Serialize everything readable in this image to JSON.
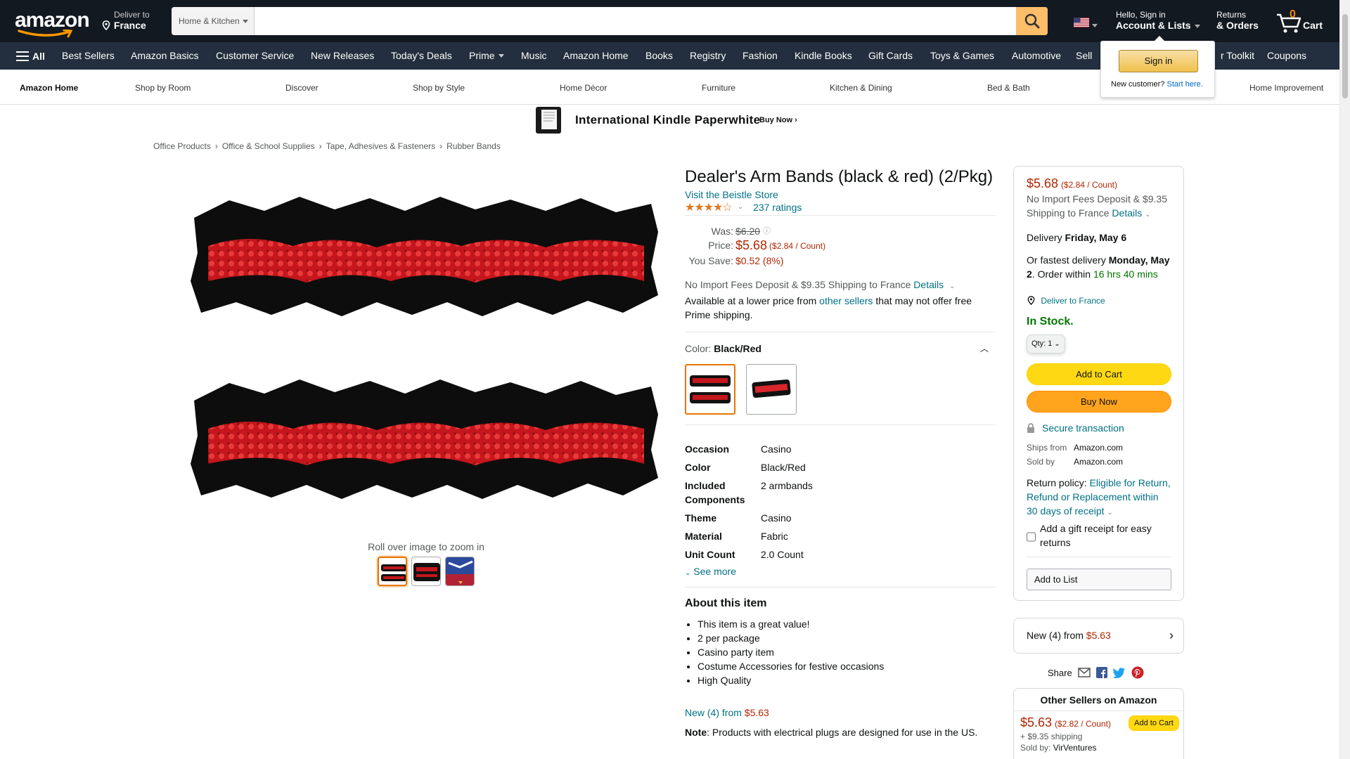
{
  "header": {
    "logo": "amazon",
    "deliver_line1": "Deliver to",
    "deliver_line2": "France",
    "search_category": "Home & Kitchen",
    "search_value": "",
    "account_line1": "Hello, Sign in",
    "account_line2": "Account & Lists",
    "orders_line1": "Returns",
    "orders_line2": "& Orders",
    "cart_count": "0",
    "cart_label": "Cart"
  },
  "nav": {
    "all_label": "All",
    "items": [
      "Best Sellers",
      "Amazon Basics",
      "Customer Service",
      "New Releases",
      "Today's Deals",
      "Prime",
      "Music",
      "Amazon Home",
      "Books",
      "Registry",
      "Fashion",
      "Kindle Books",
      "Gift Cards",
      "Toys & Games",
      "Automotive",
      "Sell",
      "r Toolkit",
      "Coupons"
    ]
  },
  "subnav": {
    "items": [
      "Amazon Home",
      "Shop by Room",
      "Discover",
      "Shop by Style",
      "Home Décor",
      "Furniture",
      "Kitchen & Dining",
      "Bed & Bath",
      "Home Improvement"
    ]
  },
  "signin_popup": {
    "button": "Sign in",
    "new_customer": "New customer?",
    "start_here": "Start here."
  },
  "banner": {
    "title": "International Kindle Paperwhite",
    "cta": "Buy Now ›"
  },
  "breadcrumb": [
    "Office Products",
    "Office & School Supplies",
    "Tape, Adhesives & Fasteners",
    "Rubber Bands"
  ],
  "gallery": {
    "zoom_hint": "Roll over image to zoom in"
  },
  "product": {
    "title": "Dealer's Arm Bands (black & red) (2/Pkg)",
    "store_link": "Visit the Beistle Store",
    "rating": 3.9,
    "ratings_count": "237 ratings",
    "was_label": "Was:",
    "was_price": "$6.20",
    "price_label": "Price:",
    "price": "$5.68",
    "price_unit": "($2.84 / Count)",
    "save_label": "You Save:",
    "save_value": "$0.52 (8%)",
    "import_text": "No Import Fees Deposit & $9.35 Shipping to France",
    "details_link": "Details",
    "avail_text1": "Available at a lower price from",
    "avail_link": "other sellers",
    "avail_text2": "that may not offer free Prime shipping.",
    "color_label": "Color:",
    "color_value": "Black/Red",
    "specs": [
      {
        "k": "Occasion",
        "v": "Casino"
      },
      {
        "k": "Color",
        "v": "Black/Red"
      },
      {
        "k": "Included Components",
        "v": "2 armbands"
      },
      {
        "k": "Theme",
        "v": "Casino"
      },
      {
        "k": "Material",
        "v": "Fabric"
      },
      {
        "k": "Unit Count",
        "v": "2.0 Count"
      }
    ],
    "see_more": "See more",
    "about_title": "About this item",
    "about_items": [
      "This item is a great value!",
      "2 per package",
      "Casino party item",
      "Costume Accessories for festive occasions",
      "High Quality"
    ],
    "new_from_text": "New (4) from",
    "new_from_price": "$5.63",
    "note_label": "Note",
    "note_text": ": Products with electrical plugs are designed for use in the US."
  },
  "buybox": {
    "price": "$5.68",
    "price_unit": "($2.84 / Count)",
    "import_line1": "No Import Fees Deposit & $9.35",
    "import_line2": "Shipping to France",
    "details": "Details",
    "delivery_label": "Delivery",
    "delivery_date": "Friday, May 6",
    "fastest_label": "Or fastest delivery",
    "fastest_date": "Monday, May 2",
    "order_within": ". Order within",
    "countdown": "16 hrs 40 mins",
    "deliver_to": "Deliver to France",
    "stock": "In Stock.",
    "qty": "Qty: 1",
    "add_to_cart": "Add to Cart",
    "buy_now": "Buy Now",
    "secure": "Secure transaction",
    "ships_from_label": "Ships from",
    "ships_from": "Amazon.com",
    "sold_by_label": "Sold by",
    "sold_by": "Amazon.com",
    "return_label": "Return policy:",
    "return_link": "Eligible for Return, Refund or Replacement within 30 days of receipt",
    "gift_receipt": "Add a gift receipt for easy returns",
    "add_to_list": "Add to List"
  },
  "new_box": {
    "text": "New (4) from",
    "price": "$5.63"
  },
  "share": {
    "label": "Share"
  },
  "other_sellers": {
    "title": "Other Sellers on Amazon",
    "price": "$5.63",
    "price_unit": "($2.82 / Count)",
    "shipping": "+ $9.35 shipping",
    "sold_by_label": "Sold by:",
    "sold_by": "VirVentures",
    "add_to_cart": "Add to Cart"
  },
  "colors": {
    "nav_dark": "#131921",
    "nav_secondary": "#232f3e",
    "price_red": "#b12704",
    "link_teal": "#007185",
    "cart_yellow": "#ffd814",
    "buy_orange": "#ffa41c",
    "stock_green": "#007600"
  }
}
